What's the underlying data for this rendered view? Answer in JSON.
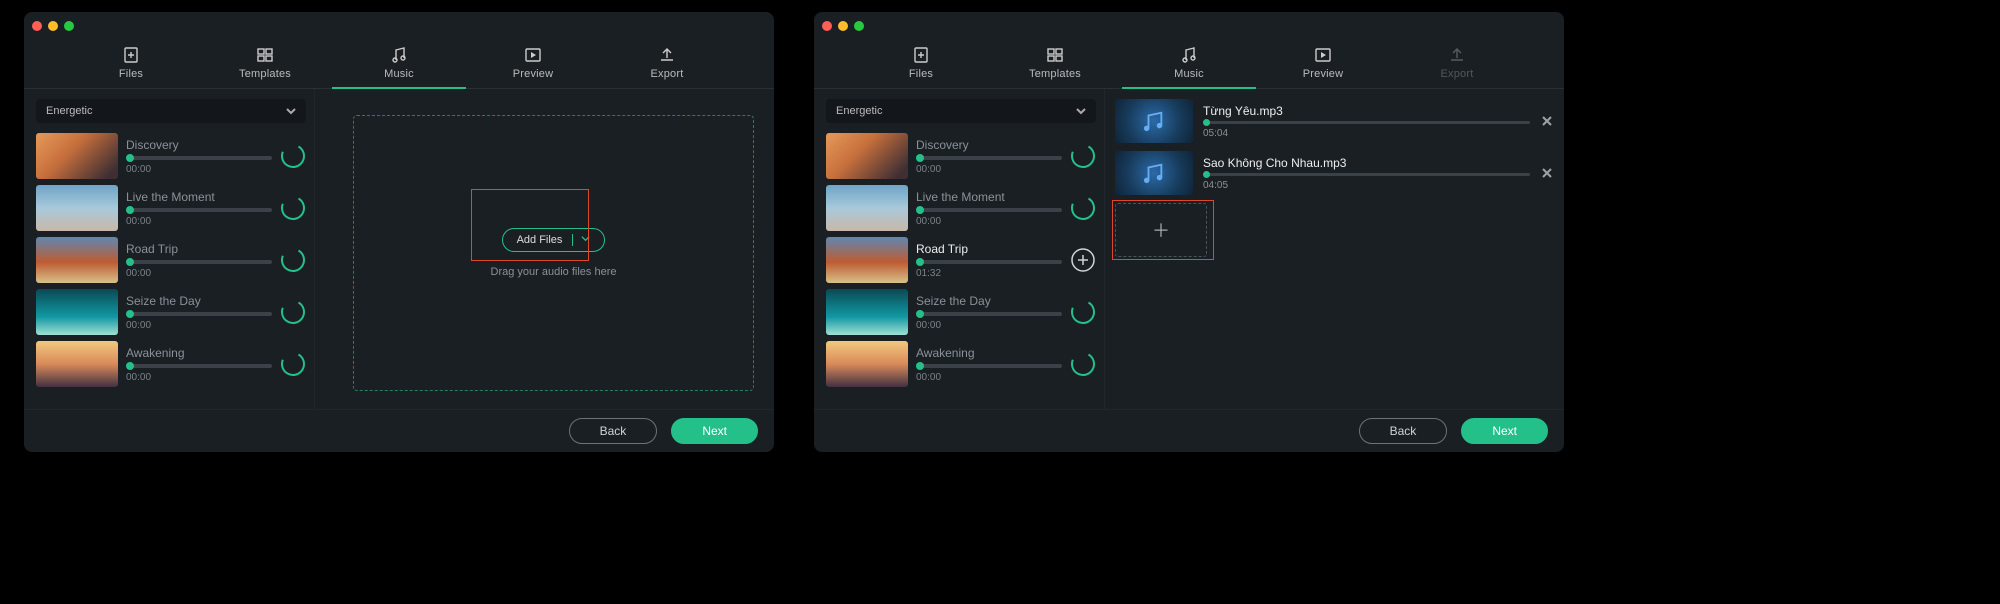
{
  "tabs": {
    "files": "Files",
    "templates": "Templates",
    "music": "Music",
    "preview": "Preview",
    "export": "Export"
  },
  "category": "Energetic",
  "tracks": [
    {
      "title": "Discovery",
      "time": "00:00"
    },
    {
      "title": "Live the Moment",
      "time": "00:00"
    },
    {
      "title": "Road Trip",
      "time": "00:00"
    },
    {
      "title": "Seize the Day",
      "time": "00:00"
    },
    {
      "title": "Awakening",
      "time": "00:00"
    }
  ],
  "w2_tracks": [
    {
      "title": "Discovery",
      "time": "00:00",
      "active": false
    },
    {
      "title": "Live the Moment",
      "time": "00:00",
      "active": false
    },
    {
      "title": "Road Trip",
      "time": "01:32",
      "active": true
    },
    {
      "title": "Seize the Day",
      "time": "00:00",
      "active": false
    },
    {
      "title": "Awakening",
      "time": "00:00",
      "active": false
    }
  ],
  "addfiles_label": "Add Files",
  "drag_hint": "Drag your audio files here",
  "files_added": [
    {
      "name": "Từng Yêu.mp3",
      "time": "05:04"
    },
    {
      "name": "Sao Không Cho Nhau.mp3",
      "time": "04:05"
    }
  ],
  "back_label": "Back",
  "next_label": "Next"
}
